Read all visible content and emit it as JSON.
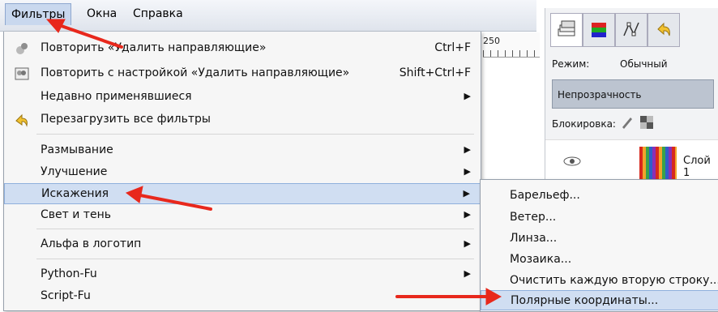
{
  "menubar": {
    "items": [
      {
        "label": "Фильтры"
      },
      {
        "label": "Окна"
      },
      {
        "label": "Справка"
      }
    ]
  },
  "ruler": {
    "label": "250"
  },
  "filters_menu": {
    "items": [
      {
        "label": "Повторить «Удалить направляющие»",
        "shortcut": "Ctrl+F",
        "icon": "repeat-filter-icon"
      },
      {
        "label": "Повторить с настройкой «Удалить направляющие»",
        "shortcut": "Shift+Ctrl+F",
        "icon": "reshow-filter-icon"
      },
      {
        "label": "Недавно применявшиеся",
        "submenu": true
      },
      {
        "label": "Перезагрузить все фильтры",
        "icon": "reload-icon"
      },
      {
        "label": "Размывание",
        "submenu": true
      },
      {
        "label": "Улучшение",
        "submenu": true
      },
      {
        "label": "Искажения",
        "submenu": true,
        "highlighted": true
      },
      {
        "label": "Свет и тень",
        "submenu": true
      },
      {
        "label": "Альфа в логотип",
        "submenu": true
      },
      {
        "label": "Python-Fu",
        "submenu": true
      },
      {
        "label": "Script-Fu"
      }
    ]
  },
  "distorts_submenu": {
    "items": [
      {
        "label": "Барельеф..."
      },
      {
        "label": "Ветер..."
      },
      {
        "label": "Линза..."
      },
      {
        "label": "Мозаика..."
      },
      {
        "label": "Очистить каждую вторую строку..."
      },
      {
        "label": "Полярные координаты...",
        "highlighted": true
      }
    ]
  },
  "layers_panel": {
    "mode_label": "Режим:",
    "mode_value": "Обычный",
    "opacity_label": "Непрозрачность",
    "lock_label": "Блокировка:",
    "layer_name": "Слой 1"
  },
  "colors": {
    "highlight": "#d0def2",
    "annotation_arrow": "#e8281c"
  }
}
